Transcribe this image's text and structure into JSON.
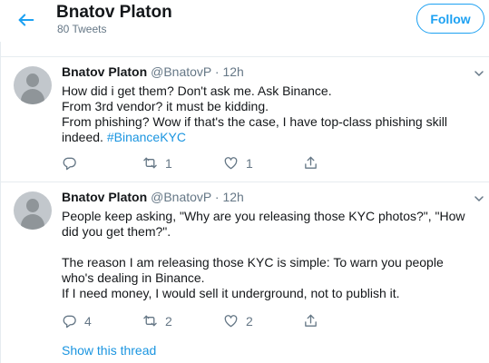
{
  "header": {
    "title": "Bnatov Platon",
    "tweet_count": "80 Tweets",
    "follow_label": "Follow"
  },
  "colors": {
    "accent": "#1da1f2",
    "link": "#1b95e0",
    "secondary_text": "#657786",
    "border": "#e6ecf0"
  },
  "icons": {
    "back": "back-arrow-icon",
    "caret": "chevron-down-icon",
    "reply": "reply-icon",
    "retweet": "retweet-icon",
    "like": "heart-icon",
    "share": "share-icon"
  },
  "tweets": [
    {
      "name": "Bnatov Platon",
      "handle": "@BnatovP",
      "separator": "·",
      "time": "12h",
      "lines": [
        "How did i get them? Don't ask me. Ask Binance.",
        "From 3rd vendor? it must be kidding.",
        "From phishing? Wow if that's the case, I have top-class phishing skill",
        "indeed."
      ],
      "hashtag": "#BinanceKYC",
      "replies": "",
      "retweets": "1",
      "likes": "1"
    },
    {
      "name": "Bnatov Platon",
      "handle": "@BnatovP",
      "separator": "·",
      "time": "12h",
      "lines": [
        "People keep asking, \"Why are you releasing those KYC photos?\", \"How",
        "did you get them?\".",
        "",
        "The reason I am releasing those KYC is simple: To warn you people",
        "who's dealing in Binance.",
        "If I need money, I would sell it underground, not to publish it."
      ],
      "replies": "4",
      "retweets": "2",
      "likes": "2",
      "show_thread": "Show this thread"
    }
  ]
}
